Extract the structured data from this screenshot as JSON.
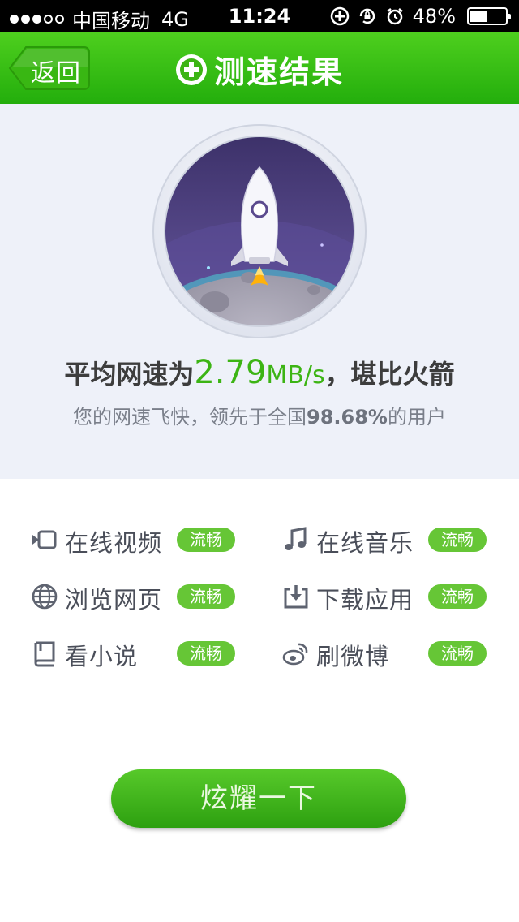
{
  "status_bar": {
    "carrier": "中国移动",
    "network": "4G",
    "time": "11:24",
    "battery": "48%",
    "battery_level": 0.48
  },
  "nav": {
    "back_label": "返回",
    "title": "测速结果"
  },
  "result": {
    "prefix": "平均网速为",
    "speed_value": "2.79",
    "speed_unit": "MB/s",
    "suffix": "，堪比火箭",
    "sub_prefix": "您的网速飞快，领先于全国",
    "percentile": "98.68%",
    "sub_suffix": "的用户"
  },
  "items": [
    {
      "label": "在线视频",
      "status": "流畅",
      "icon": "video-icon"
    },
    {
      "label": "在线音乐",
      "status": "流畅",
      "icon": "music-icon"
    },
    {
      "label": "浏览网页",
      "status": "流畅",
      "icon": "globe-icon"
    },
    {
      "label": "下载应用",
      "status": "流畅",
      "icon": "download-icon"
    },
    {
      "label": "看小说",
      "status": "流畅",
      "icon": "book-icon"
    },
    {
      "label": "刷微博",
      "status": "流畅",
      "icon": "weibo-icon"
    }
  ],
  "cta_label": "炫耀一下",
  "colors": {
    "brand_green": "#3cb414",
    "badge_green": "#66c636",
    "hero_bg": "#eef1f9"
  }
}
